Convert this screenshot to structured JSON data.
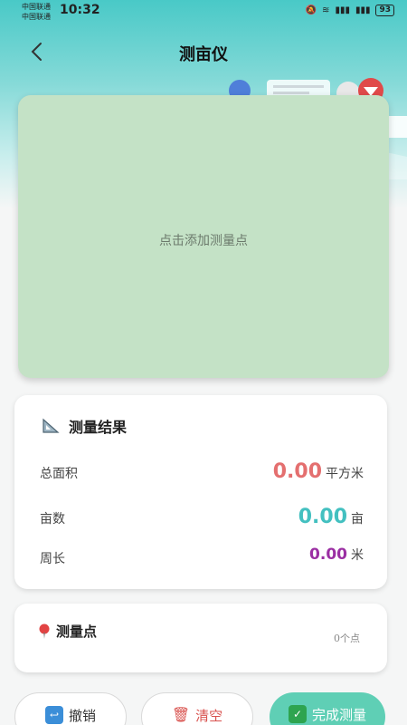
{
  "status_bar": {
    "carrier_1": "中国联通",
    "carrier_2": "中国联通",
    "time": "10:32",
    "battery": "93"
  },
  "header": {
    "title": "测亩仪"
  },
  "map": {
    "hint": "点击添加测量点"
  },
  "results": {
    "title": "测量结果",
    "rows": [
      {
        "label": "总面积",
        "value": "0.00",
        "unit": "平方米",
        "color": "#e46f6f"
      },
      {
        "label": "亩数",
        "value": "0.00",
        "unit": "亩",
        "color": "#43c0c0"
      },
      {
        "label": "周长",
        "value": "0.00",
        "unit": "米",
        "color": "#9b2fa3"
      }
    ]
  },
  "points": {
    "title": "测量点",
    "count": "0个点"
  },
  "actions": {
    "undo_label": "撤销",
    "clear_label": "清空",
    "done_label": "完成测量"
  },
  "colors": {
    "accent": "#49c9c7",
    "map_bg": "#c4e2c6",
    "done_button": "#5fcfb5"
  }
}
